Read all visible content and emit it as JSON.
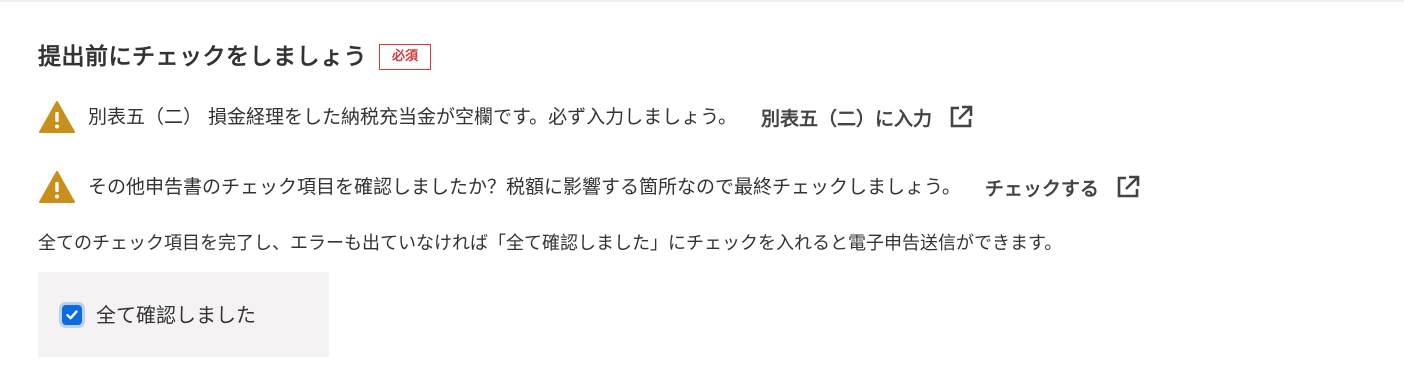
{
  "section": {
    "title": "提出前にチェックをしましょう",
    "required_badge": "必須"
  },
  "checks": [
    {
      "icon": "warning-icon",
      "message": "別表五（二） 損金経理をした納税充当金が空欄です。必ず入力しましょう。",
      "link_label": "別表五（二）に入力",
      "link_icon": "external-link-icon"
    },
    {
      "icon": "warning-icon",
      "message": "その他申告書のチェック項目を確認しましたか？税額に影響する箇所なので最終チェックしましょう。",
      "link_label": "チェックする",
      "link_icon": "external-link-icon"
    }
  ],
  "instruction": "全てのチェック項目を完了し、エラーも出ていなければ「全て確認しました」にチェックを入れると電子申告送信ができます。",
  "confirm": {
    "label": "全て確認しました",
    "checked": true
  },
  "colors": {
    "warning": "#c8901a",
    "required": "#d33a3a",
    "checkbox": "#0b6cdf",
    "confirm_bg": "#f4f2f2"
  }
}
